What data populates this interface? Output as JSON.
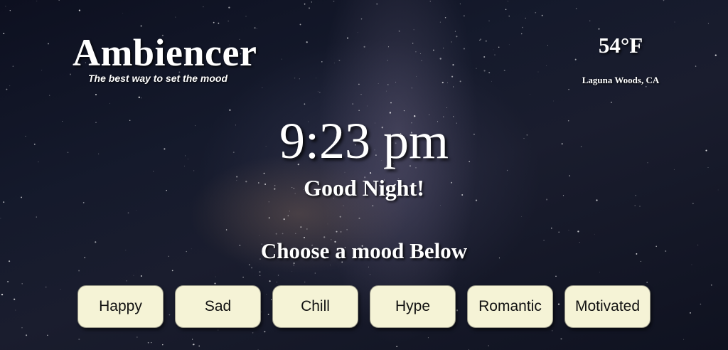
{
  "app": {
    "title": "Ambiencer",
    "tagline": "The best way to set the mood"
  },
  "weather": {
    "temperature": "54°F",
    "location": "Laguna Woods, CA"
  },
  "clock": {
    "time": "9:23 pm",
    "greeting": "Good Night!"
  },
  "moods": {
    "heading": "Choose a mood Below",
    "options": [
      "Happy",
      "Sad",
      "Chill",
      "Hype",
      "Romantic",
      "Motivated"
    ]
  },
  "colors": {
    "button_background": "#f5f3d6",
    "button_text": "#111111",
    "text": "#ffffff",
    "background": "#151a2c"
  }
}
